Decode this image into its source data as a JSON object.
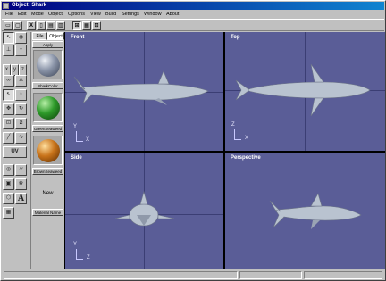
{
  "window": {
    "title": "Object: Shark"
  },
  "menu": [
    "File",
    "Edit",
    "Mode",
    "Object",
    "Options",
    "View",
    "Build",
    "Settings",
    "Window",
    "About"
  ],
  "toolbar": {
    "icons": [
      "new-file-icon",
      "open-file-icon",
      "text-tool-icon",
      "cut-icon",
      "copy-icon",
      "paste-icon",
      "four-view-icon",
      "single-view-icon",
      "zoom-icon"
    ]
  },
  "left_tools": {
    "text_label": "UV",
    "font_label": "A"
  },
  "materials": {
    "tabs": [
      "File",
      "Object"
    ],
    "apply_label": "Apply",
    "items": [
      {
        "name": "SharkColor",
        "color": "#8a94a8"
      },
      {
        "name": "GreenSeaweed",
        "color": "#2e9a2a"
      },
      {
        "name": "BrownSeaweed",
        "color": "#c8731a"
      }
    ],
    "new_label": "New",
    "name_label": "Material Name"
  },
  "viewports": {
    "front": {
      "label": "Front",
      "axis_v": "Y",
      "axis_h": "X"
    },
    "top": {
      "label": "Top",
      "axis_v": "Z",
      "axis_h": "X"
    },
    "side": {
      "label": "Side",
      "axis_v": "Y",
      "axis_h": "Z"
    },
    "perspective": {
      "label": "Perspective"
    }
  },
  "colors": {
    "viewport_bg": "#5a5d97",
    "title_bar": "#000080",
    "shark": "#b9c3d0"
  }
}
